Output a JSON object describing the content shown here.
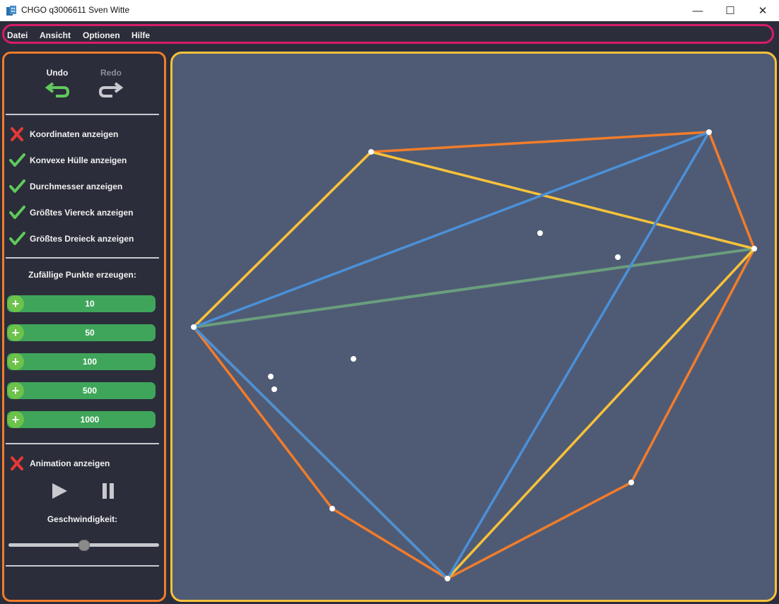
{
  "window": {
    "title": "CHGO q3006611 Sven Witte",
    "minimize_glyph": "—",
    "maximize_glyph": "☐",
    "close_glyph": "✕"
  },
  "menu": [
    "Datei",
    "Ansicht",
    "Optionen",
    "Hilfe"
  ],
  "history": {
    "undo_label": "Undo",
    "redo_label": "Redo",
    "undo_icon": "undo-arrow-icon",
    "redo_icon": "redo-arrow-icon",
    "undo_color": "#5fca5b",
    "redo_color": "#c8c9ce"
  },
  "options": [
    {
      "label": "Koordinaten anzeigen",
      "checked": false
    },
    {
      "label": "Konvexe Hülle anzeigen",
      "checked": true
    },
    {
      "label": "Durchmesser anzeigen",
      "checked": true
    },
    {
      "label": "Größtes Viereck anzeigen",
      "checked": true
    },
    {
      "label": "Größtes Dreieck anzeigen",
      "checked": true
    }
  ],
  "random_points": {
    "title": "Zufällige Punkte erzeugen:",
    "buttons": [
      "10",
      "50",
      "100",
      "500",
      "1000"
    ]
  },
  "animation": {
    "label": "Animation anzeigen",
    "checked": false,
    "speed_label": "Geschwindigkeit:",
    "speed": 0.5
  },
  "colors": {
    "accent_menu": "#d81b6a",
    "accent_sidebar": "#f27c2b",
    "accent_canvas": "#f8c23a",
    "check": "#5fca5b",
    "cross": "#e53935",
    "hull": "#f27c2b",
    "quad": "#f8c23a",
    "triangle": "#4a90d9",
    "diameter": "#6a9e7e",
    "canvas_bg": "#4f5b74"
  }
}
